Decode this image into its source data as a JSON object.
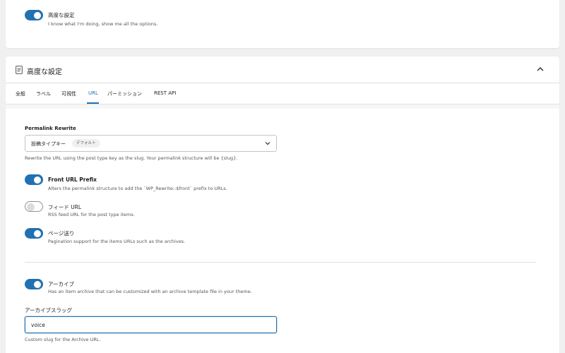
{
  "top_card": {
    "toggle_label": "高度な設定",
    "toggle_help": "I know what I'm doing, show me all the options."
  },
  "panel": {
    "title": "高度な設定",
    "tabs": [
      {
        "label": "全般"
      },
      {
        "label": "ラベル"
      },
      {
        "label": "可視性"
      },
      {
        "label": "URL"
      },
      {
        "label": "パーミッション"
      },
      {
        "label": "REST API"
      }
    ],
    "active_tab": "URL"
  },
  "url_settings": {
    "permalink_label": "Permalink Rewrite",
    "permalink_value": "投稿タイプキー",
    "permalink_badge": "デフォルト",
    "permalink_help": "Rewrite the URL using the post type key as the slug. Your permalink structure will be {slug}.",
    "front_prefix_label": "Front URL Prefix",
    "front_prefix_help": "Alters the permalink structure to add the `WP_Rewrite::$front` prefix to URLs.",
    "feed_label": "フィード URL",
    "feed_help": "RSS feed URL for the post type items.",
    "pagination_label": "ページ送り",
    "pagination_help": "Pagination support for the items URLs such as the archives.",
    "archive_label": "アーカイブ",
    "archive_help": "Has an item archive that can be customized with an archive template file in your theme.",
    "archive_slug_label": "アーカイブスラッグ",
    "archive_slug_value": "voice",
    "archive_slug_help": "Custom slug for the Archive URL."
  },
  "colors": {
    "accent": "#2271b1",
    "background": "#f0f0f1"
  },
  "icons": {
    "panel_icon": "document-icon",
    "collapse_icon": "chevron-up-icon",
    "select_icon": "chevron-down-icon"
  }
}
